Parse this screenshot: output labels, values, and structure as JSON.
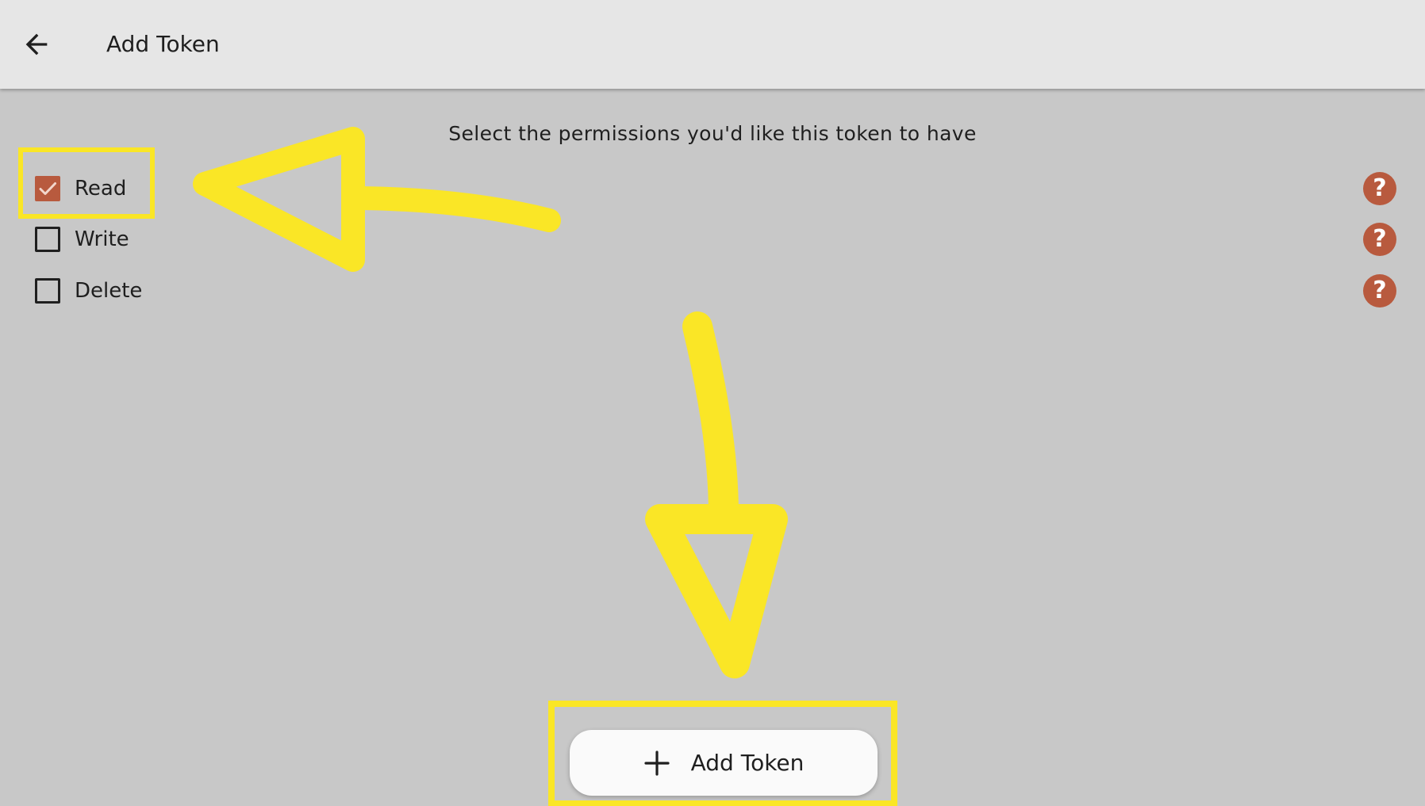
{
  "app_bar": {
    "title": "Add Token",
    "back_icon": "arrow-left-icon"
  },
  "instructions": "Select the permissions you'd like this token to have",
  "permissions": [
    {
      "label": "Read",
      "checked": true
    },
    {
      "label": "Write",
      "checked": false
    },
    {
      "label": "Delete",
      "checked": false
    }
  ],
  "help_icon": "question-mark-icon",
  "add_button": {
    "label": "Add Token",
    "icon": "plus-icon"
  },
  "colors": {
    "app_bar_bg": "#e6e6e6",
    "page_bg": "#c8c8c8",
    "accent": "#b85a3e",
    "annotation": "#fae626"
  }
}
